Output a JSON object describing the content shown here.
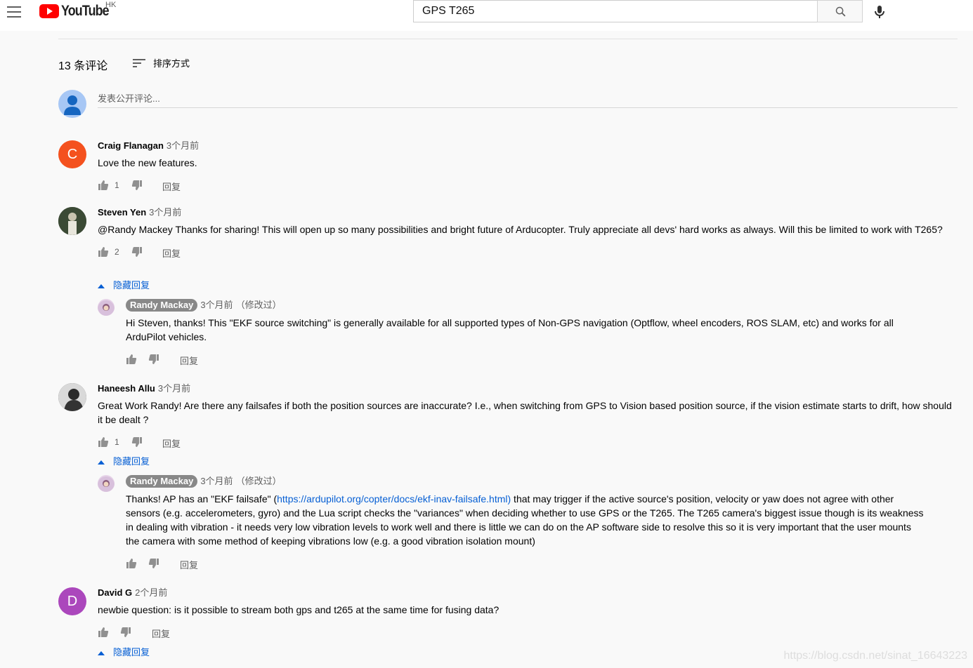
{
  "header": {
    "logo_text": "YouTube",
    "region": "HK",
    "search_value": "GPS T265"
  },
  "comments_section": {
    "count_label": "13 条评论",
    "sort_label": "排序方式",
    "add_placeholder": "发表公开评论..."
  },
  "comments": [
    {
      "author": "Craig Flanagan",
      "avatar_letter": "C",
      "avatar_color": "#f4511e",
      "time": "3个月前",
      "text": "Love the new features.",
      "likes": "1",
      "reply_label": "回复"
    },
    {
      "author": "Steven Yen",
      "time": "3个月前",
      "text": "@Randy Mackey Thanks for sharing! This will open up so many possibilities and bright future of Arducopter. Truly appreciate all devs' hard works as always.  Will this be limited to work with T265?",
      "likes": "2",
      "reply_label": "回复",
      "hide_replies_label": "隐藏回复",
      "reply": {
        "author": "Randy Mackay",
        "time": "3个月前",
        "edited": "（修改过）",
        "text": "Hi Steven, thanks!  This \"EKF source switching\" is generally available for all supported types of Non-GPS navigation (Optflow, wheel encoders, ROS SLAM, etc) and works for all ArduPilot vehicles.",
        "reply_label": "回复"
      }
    },
    {
      "author": "Haneesh Allu",
      "time": "3个月前",
      "text": "Great Work Randy! Are there any failsafes if both the position sources are inaccurate? I.e., when switching from GPS to Vision based position source, if the vision estimate starts to drift, how should it be dealt ?",
      "likes": "1",
      "reply_label": "回复",
      "hide_replies_label": "隐藏回复",
      "reply": {
        "author": "Randy Mackay",
        "time": "3个月前",
        "edited": "（修改过）",
        "text_before": "Thanks! AP has an \"EKF failsafe\" (",
        "link": "https://ardupilot.org/copter/docs/ekf-inav-failsafe.html)",
        "text_after": " that may trigger if the active source's position, velocity or yaw does not agree with other sensors (e.g. accelerometers, gyro) and the Lua script checks the \"variances\" when deciding whether to use GPS or the T265.  The T265 camera's biggest issue though is its weakness in dealing with vibration - it needs very low vibration levels to work well and there is little we can do on the AP software side to resolve this so it is very important that the user mounts the camera with some method of keeping vibrations low (e.g. a good vibration isolation mount)",
        "reply_label": "回复"
      }
    },
    {
      "author": "David G",
      "avatar_letter": "D",
      "avatar_color": "#ab47bc",
      "time": "2个月前",
      "text": "newbie question:  is it possible to stream both gps and t265 at the same time for fusing data?",
      "reply_label": "回复",
      "hide_replies_label": "隐藏回复"
    }
  ],
  "watermark": "https://blog.csdn.net/sinat_16643223"
}
